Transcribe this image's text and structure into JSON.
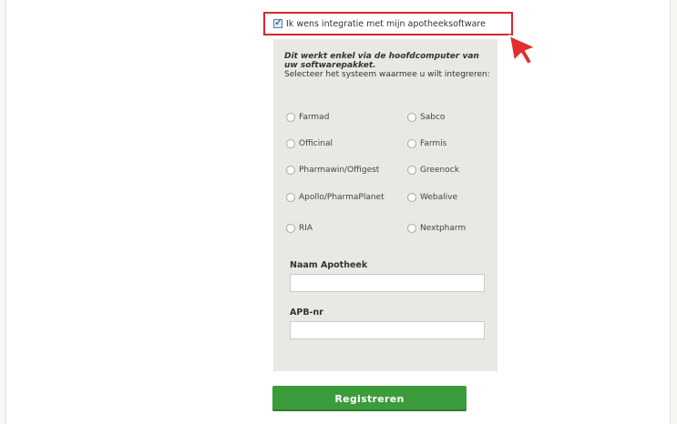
{
  "optin": {
    "label": "Ik wens integratie met mijn apotheeksoftware",
    "checked": true
  },
  "panel": {
    "intro_strong": "Dit werkt enkel via de hoofdcomputer van uw softwarepakket.",
    "intro_plain": "Selecteer het systeem waarmee u wilt integreren:",
    "options_left": [
      "Farmad",
      "Officinal",
      "Pharmawin/Offigest",
      "Apollo/PharmaPlanet",
      "RIA"
    ],
    "options_right": [
      "Sabco",
      "Farmis",
      "Greenock",
      "Webalive",
      "Nextpharm"
    ]
  },
  "fields": {
    "pharmacy_label": "Naam Apotheek",
    "apb_label": "APB-nr"
  },
  "submit_label": "Registreren",
  "colors": {
    "highlight": "#d8262f",
    "button": "#3c9b3a",
    "panel": "#e9e8e3"
  }
}
